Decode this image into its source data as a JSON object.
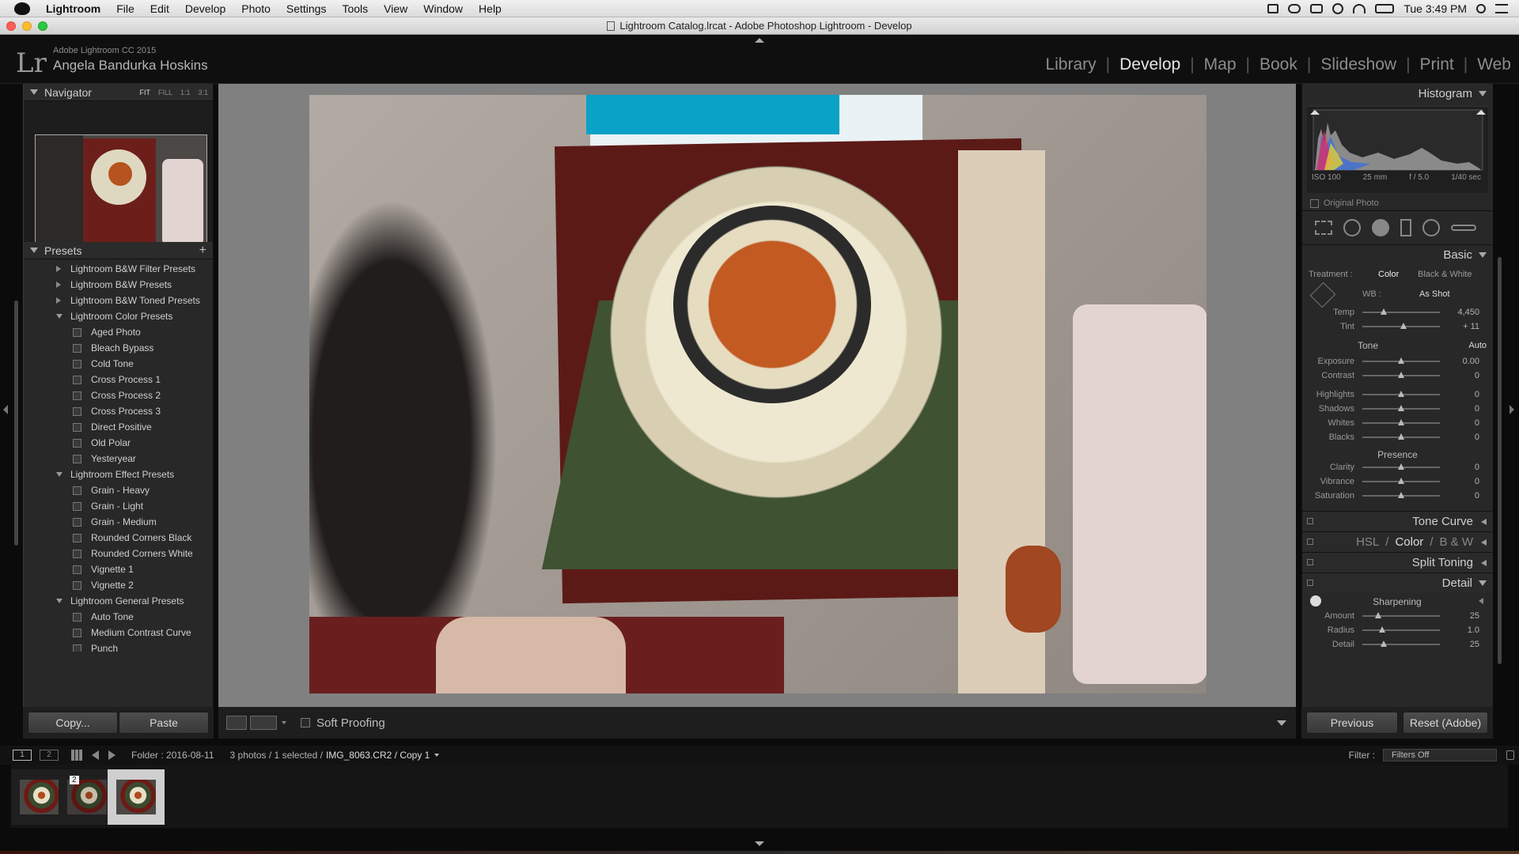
{
  "menubar": {
    "app": "Lightroom",
    "items": [
      "File",
      "Edit",
      "Develop",
      "Photo",
      "Settings",
      "Tools",
      "View",
      "Window",
      "Help"
    ],
    "clock": "Tue 3:49 PM"
  },
  "window": {
    "title": "Lightroom Catalog.lrcat - Adobe Photoshop Lightroom - Develop"
  },
  "identity": {
    "product": "Adobe Lightroom CC 2015",
    "user": "Angela Bandurka Hoskins",
    "logo": "Lr"
  },
  "modules": [
    "Library",
    "Develop",
    "Map",
    "Book",
    "Slideshow",
    "Print",
    "Web"
  ],
  "active_module": "Develop",
  "navigator": {
    "title": "Navigator",
    "zoom": [
      "FIT",
      "FILL",
      "1:1",
      "3:1"
    ]
  },
  "presets": {
    "title": "Presets",
    "rows": [
      {
        "type": "folder",
        "open": false,
        "label": "Lightroom B&W Filter Presets"
      },
      {
        "type": "folder",
        "open": false,
        "label": "Lightroom B&W Presets"
      },
      {
        "type": "folder",
        "open": false,
        "label": "Lightroom B&W Toned Presets"
      },
      {
        "type": "folder",
        "open": true,
        "label": "Lightroom Color Presets"
      },
      {
        "type": "item",
        "label": "Aged Photo"
      },
      {
        "type": "item",
        "label": "Bleach Bypass"
      },
      {
        "type": "item",
        "label": "Cold Tone"
      },
      {
        "type": "item",
        "label": "Cross Process 1"
      },
      {
        "type": "item",
        "label": "Cross Process 2"
      },
      {
        "type": "item",
        "label": "Cross Process 3"
      },
      {
        "type": "item",
        "label": "Direct Positive"
      },
      {
        "type": "item",
        "label": "Old Polar"
      },
      {
        "type": "item",
        "label": "Yesteryear"
      },
      {
        "type": "folder",
        "open": true,
        "label": "Lightroom Effect Presets"
      },
      {
        "type": "item",
        "label": "Grain - Heavy"
      },
      {
        "type": "item",
        "label": "Grain - Light"
      },
      {
        "type": "item",
        "label": "Grain - Medium"
      },
      {
        "type": "item",
        "label": "Rounded Corners Black"
      },
      {
        "type": "item",
        "label": "Rounded Corners White"
      },
      {
        "type": "item",
        "label": "Vignette 1"
      },
      {
        "type": "item",
        "label": "Vignette 2"
      },
      {
        "type": "folder",
        "open": true,
        "label": "Lightroom General Presets"
      },
      {
        "type": "item",
        "label": "Auto Tone"
      },
      {
        "type": "item",
        "label": "Medium Contrast Curve"
      },
      {
        "type": "item",
        "label": "Punch"
      }
    ]
  },
  "left_buttons": {
    "copy": "Copy...",
    "paste": "Paste"
  },
  "toolbar": {
    "soft_proofing": "Soft Proofing"
  },
  "histogram": {
    "title": "Histogram",
    "iso": "ISO 100",
    "focal": "25 mm",
    "aperture": "f / 5.0",
    "shutter": "1/40 sec",
    "original": "Original Photo"
  },
  "basic": {
    "title": "Basic",
    "treatment_label": "Treatment :",
    "treatment_color": "Color",
    "treatment_bw": "Black & White",
    "wb_label": "WB :",
    "wb_value": "As Shot",
    "tone_label": "Tone",
    "auto": "Auto",
    "presence_label": "Presence",
    "wb_sliders": [
      {
        "label": "Temp",
        "value": "4,450",
        "pos": 0.28
      },
      {
        "label": "Tint",
        "value": "+ 11",
        "pos": 0.53
      }
    ],
    "tone_sliders": [
      {
        "label": "Exposure",
        "value": "0.00",
        "pos": 0.5
      },
      {
        "label": "Contrast",
        "value": "0",
        "pos": 0.5
      }
    ],
    "tone_sliders2": [
      {
        "label": "Highlights",
        "value": "0",
        "pos": 0.5
      },
      {
        "label": "Shadows",
        "value": "0",
        "pos": 0.5
      },
      {
        "label": "Whites",
        "value": "0",
        "pos": 0.5
      },
      {
        "label": "Blacks",
        "value": "0",
        "pos": 0.5
      }
    ],
    "presence_sliders": [
      {
        "label": "Clarity",
        "value": "0",
        "pos": 0.5
      },
      {
        "label": "Vibrance",
        "value": "0",
        "pos": 0.5
      },
      {
        "label": "Saturation",
        "value": "0",
        "pos": 0.5
      }
    ]
  },
  "panels": {
    "tone_curve": "Tone Curve",
    "hsl": "HSL",
    "color": "Color",
    "bw": "B & W",
    "split_toning": "Split Toning",
    "detail": "Detail"
  },
  "detail": {
    "sharpening": "Sharpening",
    "sliders": [
      {
        "label": "Amount",
        "value": "25",
        "pos": 0.2
      },
      {
        "label": "Radius",
        "value": "1.0",
        "pos": 0.25
      },
      {
        "label": "Detail",
        "value": "25",
        "pos": 0.28
      }
    ]
  },
  "right_buttons": {
    "previous": "Previous",
    "reset": "Reset (Adobe)"
  },
  "filmstrip": {
    "screen1": "1",
    "screen2": "2",
    "folder": "Folder : 2016-08-11",
    "summary": "3 photos / 1 selected /",
    "filename": "IMG_8063.CR2 / Copy 1",
    "filter_label": "Filter :",
    "filter_value": "Filters Off",
    "badge": "2"
  }
}
